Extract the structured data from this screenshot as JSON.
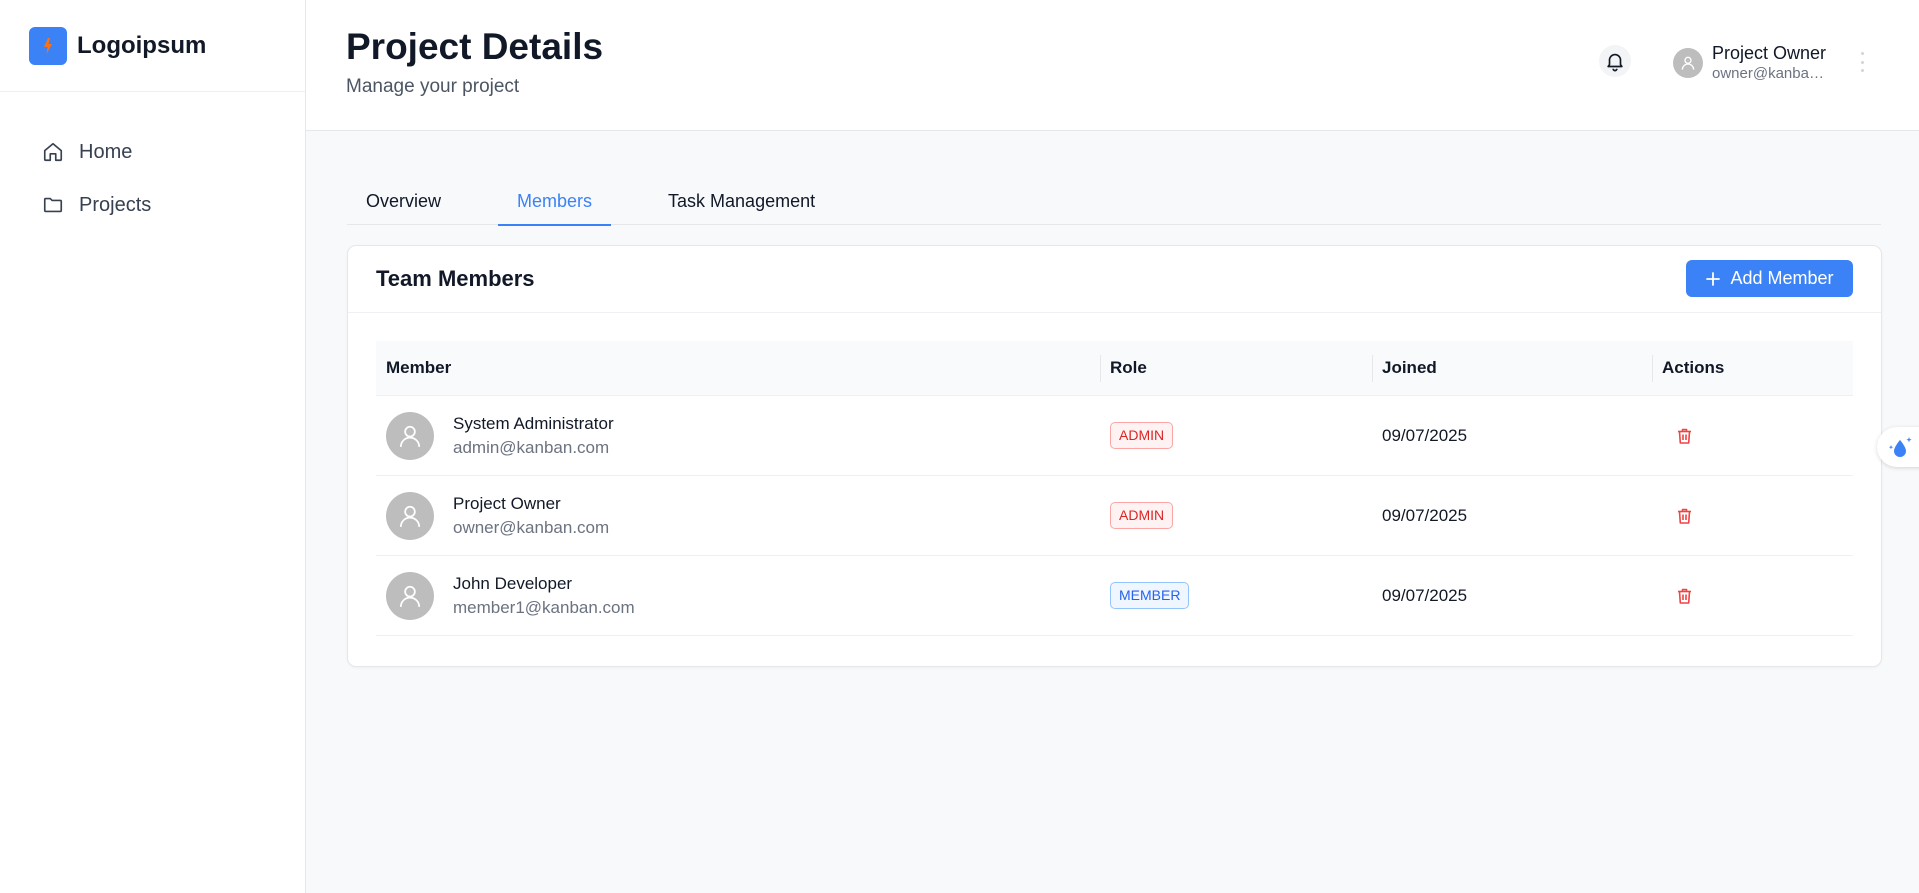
{
  "brand": {
    "name": "Logoipsum"
  },
  "sidebar": {
    "items": [
      {
        "label": "Home",
        "icon": "home-icon"
      },
      {
        "label": "Projects",
        "icon": "folder-icon"
      }
    ]
  },
  "header": {
    "title": "Project Details",
    "subtitle": "Manage your project",
    "user": {
      "name": "Project Owner",
      "email": "owner@kanban.com"
    }
  },
  "tabs": [
    {
      "label": "Overview",
      "active": false
    },
    {
      "label": "Members",
      "active": true
    },
    {
      "label": "Task Management",
      "active": false
    }
  ],
  "card": {
    "title": "Team Members",
    "add_button_label": "Add Member"
  },
  "table": {
    "headers": {
      "member": "Member",
      "role": "Role",
      "joined": "Joined",
      "actions": "Actions"
    },
    "rows": [
      {
        "name": "System Administrator",
        "email": "admin@kanban.com",
        "role": "ADMIN",
        "joined": "09/07/2025"
      },
      {
        "name": "Project Owner",
        "email": "owner@kanban.com",
        "role": "ADMIN",
        "joined": "09/07/2025"
      },
      {
        "name": "John Developer",
        "email": "member1@kanban.com",
        "role": "MEMBER",
        "joined": "09/07/2025"
      }
    ]
  },
  "colors": {
    "accent": "#3b82f6",
    "admin_badge": "#dc2626",
    "member_badge": "#2563eb",
    "delete": "#ef4444",
    "logo_flame": "#f97316"
  }
}
